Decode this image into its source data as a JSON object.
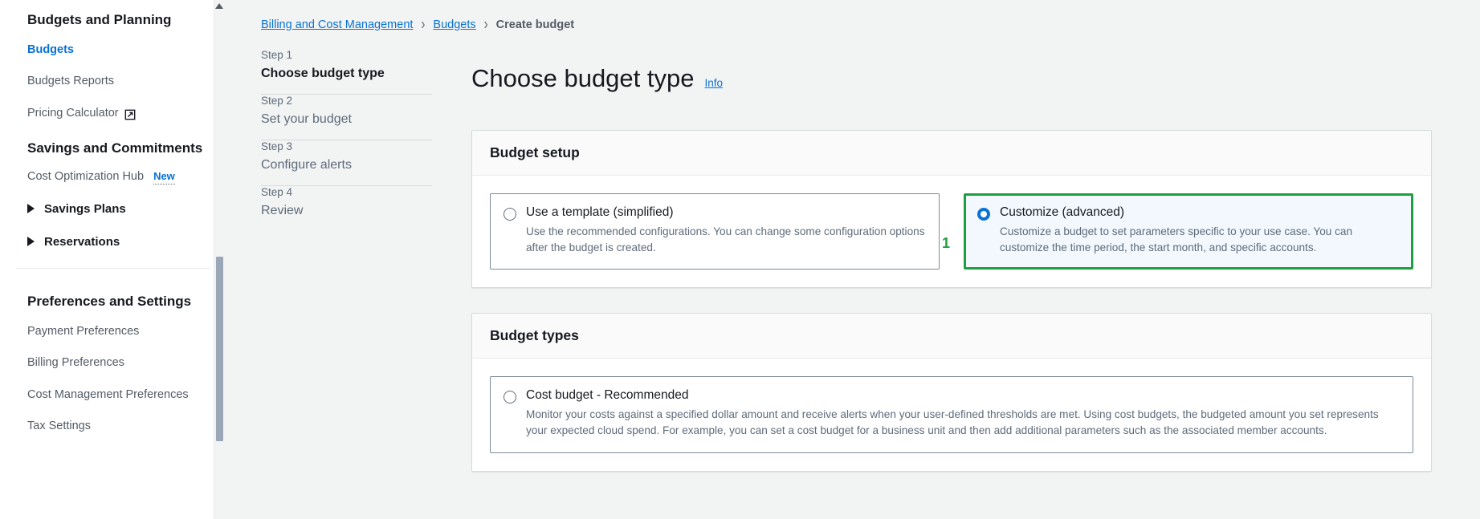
{
  "sidebar": {
    "group1_title": "Budgets and Planning",
    "links": [
      {
        "label": "Budgets",
        "active": true,
        "external": false,
        "badge": ""
      },
      {
        "label": "Budgets Reports",
        "active": false,
        "external": false,
        "badge": ""
      },
      {
        "label": "Pricing Calculator",
        "active": false,
        "external": true,
        "badge": ""
      }
    ],
    "group2_title": "Savings and Commitments",
    "links2": [
      {
        "label": "Cost Optimization Hub",
        "active": false,
        "external": false,
        "badge": "New"
      }
    ],
    "expandable": [
      {
        "label": "Savings Plans"
      },
      {
        "label": "Reservations"
      }
    ],
    "group3_title": "Preferences and Settings",
    "links3": [
      {
        "label": "Payment Preferences"
      },
      {
        "label": "Billing Preferences"
      },
      {
        "label": "Cost Management Preferences"
      },
      {
        "label": "Tax Settings"
      }
    ]
  },
  "breadcrumb": {
    "item1": "Billing and Cost Management",
    "item2": "Budgets",
    "item3": "Create budget",
    "separator": "›"
  },
  "steps": [
    {
      "num": "Step 1",
      "label": "Choose budget type"
    },
    {
      "num": "Step 2",
      "label": "Set your budget"
    },
    {
      "num": "Step 3",
      "label": "Configure alerts"
    },
    {
      "num": "Step 4",
      "label": "Review"
    }
  ],
  "main": {
    "title": "Choose budget type",
    "info_label": "Info",
    "budget_setup": {
      "card_title": "Budget setup",
      "option_template": {
        "label": "Use a template (simplified)",
        "desc": "Use the recommended configurations. You can change some configuration options after the budget is created."
      },
      "option_customize": {
        "label": "Customize (advanced)",
        "desc": "Customize a budget to set parameters specific to your use case. You can customize the time period, the start month, and specific accounts."
      },
      "annotation_marker": "1"
    },
    "budget_types": {
      "card_title": "Budget types",
      "option_cost": {
        "label": "Cost budget - Recommended",
        "desc": "Monitor your costs against a specified dollar amount and receive alerts when your user-defined thresholds are met. Using cost budgets, the budgeted amount you set represents your expected cloud spend. For example, you can set a cost budget for a business unit and then add additional parameters such as the associated member accounts."
      }
    }
  },
  "colors": {
    "link_blue": "#0972d3",
    "highlight_green": "#1d9f3f",
    "selected_fill": "#f2f8fd",
    "text_dark": "#16191f",
    "text_muted": "#5f6b7a",
    "content_bg": "#f2f3f3"
  }
}
